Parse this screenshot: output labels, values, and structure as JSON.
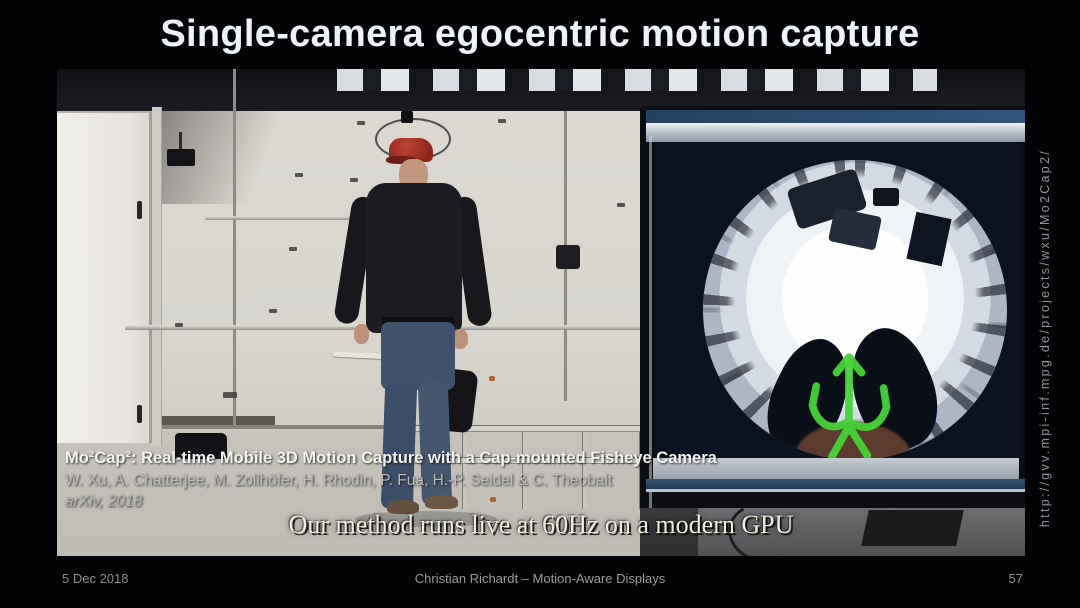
{
  "slide": {
    "title": "Single-camera egocentric motion capture",
    "side_url": "http://gvv.mpi-inf.mpg.de/projects/wxu/Mo2Cap2/",
    "footer": {
      "date": "5 Dec 2018",
      "credit": "Christian Richardt – Motion-Aware Displays",
      "page": "57"
    }
  },
  "overlay": {
    "citation_title": "Mo²Cap²: Real-time Mobile 3D Motion Capture with a Cap-mounted Fisheye Camera",
    "citation_authors": "W. Xu, A. Chatterjee, M. Zollhöfer, H. Rhodin, P. Fua, H.-P. Seidel & C. Theobalt",
    "citation_venue": "arXiv, 2018",
    "caption": "Our method runs live at 60Hz on a modern GPU"
  },
  "scene": {
    "description": "Man in red cap with head-mounted fisheye camera rig standing in a motion-capture lab; monitor shows live egocentric fisheye view with green skeleton overlay",
    "colors": {
      "background": "#030306",
      "title_text": "#eef3f7",
      "muted_text": "#8e8e8e",
      "cap_red": "#a83228",
      "skeleton_green": "#45d338",
      "monitor_bar_blue": "#2c4a6e",
      "room_wall": "#d8d5cf",
      "screen_navy": "#0a111f"
    }
  }
}
